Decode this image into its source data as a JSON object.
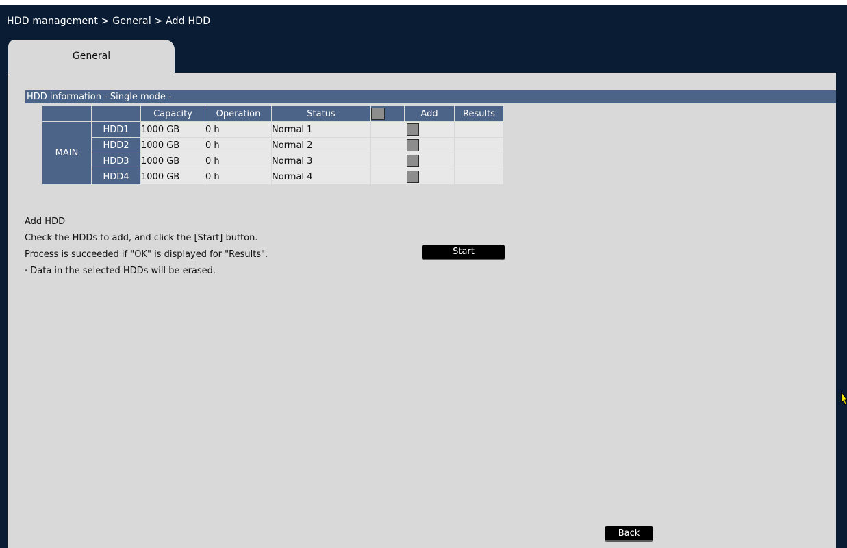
{
  "breadcrumb": "HDD management > General > Add HDD",
  "tab": {
    "label": "General"
  },
  "section": {
    "title": "HDD information - Single mode -"
  },
  "table": {
    "headers": {
      "capacity": "Capacity",
      "operation": "Operation",
      "status": "Status",
      "add": "Add",
      "results": "Results"
    },
    "group": "MAIN",
    "rows": [
      {
        "label": "HDD1",
        "capacity": "1000 GB",
        "operation": "0 h",
        "status": "Normal 1",
        "add_checked": false,
        "result": ""
      },
      {
        "label": "HDD2",
        "capacity": "1000 GB",
        "operation": "0 h",
        "status": "Normal 2",
        "add_checked": false,
        "result": ""
      },
      {
        "label": "HDD3",
        "capacity": "1000 GB",
        "operation": "0 h",
        "status": "Normal 3",
        "add_checked": false,
        "result": ""
      },
      {
        "label": "HDD4",
        "capacity": "1000 GB",
        "operation": "0 h",
        "status": "Normal 4",
        "add_checked": false,
        "result": ""
      }
    ]
  },
  "info": {
    "title": "Add HDD",
    "line1": "Check the HDDs to add, and click the [Start] button.",
    "line2": "Process is succeeded  if \"OK\" is displayed for \"Results\".",
    "line3": "· Data in the selected HDDs will be erased."
  },
  "buttons": {
    "start": "Start",
    "back": "Back"
  },
  "colors": {
    "background": "#0a1c33",
    "panel": "#d9d9d9",
    "header": "#4d6489",
    "cell": "#e8e8e8",
    "button": "#000000"
  }
}
